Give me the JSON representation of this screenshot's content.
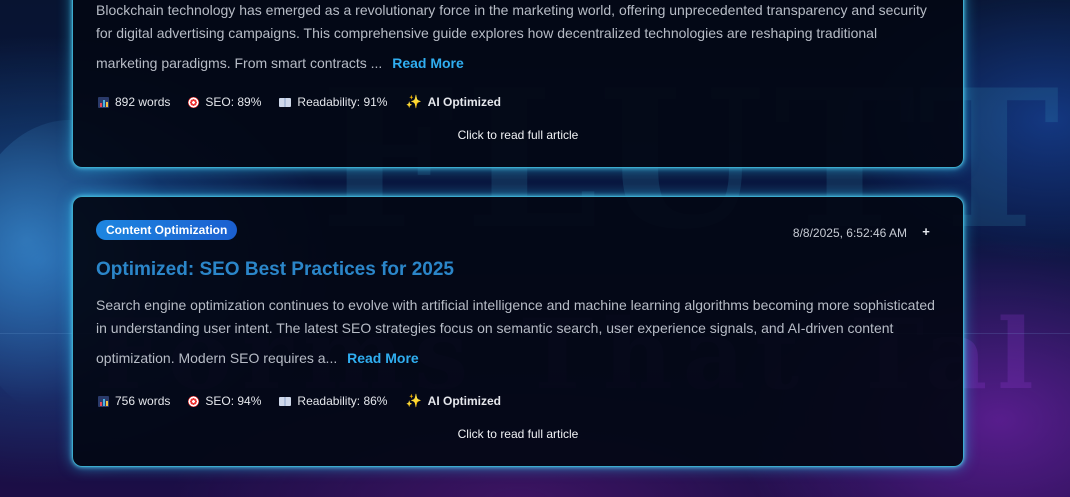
{
  "articles": [
    {
      "category": "",
      "date": "",
      "title": "",
      "excerpt_line1": "Blockchain technology has emerged as a revolutionary force in the marketing world, offering unprecedented transparency and security",
      "excerpt_line2": "for digital advertising campaigns. This comprehensive guide explores how decentralized technologies are reshaping traditional",
      "excerpt_line3": "marketing paradigms. From smart contracts ...",
      "read_more": "Read More",
      "words": "892 words",
      "seo": "SEO: 89%",
      "readability": "Readability: 91%",
      "ai_label": "AI Optimized",
      "cta": "Click to read full article"
    },
    {
      "category": "Content Optimization",
      "date": "8/8/2025, 6:52:46 AM",
      "plus": "+",
      "title": "Optimized: SEO Best Practices for 2025",
      "excerpt_line1": "Search engine optimization continues to evolve with artificial intelligence and machine learning algorithms becoming more sophisticated",
      "excerpt_line2": "in understanding user intent. The latest SEO strategies focus on semantic search, user experience signals, and AI-driven content",
      "excerpt_line3": "optimization. Modern SEO requires a...",
      "read_more": "Read More",
      "words": "756 words",
      "seo": "SEO: 94%",
      "readability": "Readability: 86%",
      "ai_label": "AI Optimized",
      "cta": "Click to read full article"
    }
  ],
  "background": {
    "word_top": "FLUTTER B",
    "word_bottom": "Forms That Tal"
  },
  "colors": {
    "accent_cyan": "#30aef0",
    "tag_blue": "#1d86e0",
    "title_blue": "#2b86c9",
    "card_glow": "#46c8f0"
  },
  "icons": {
    "words": "bar-chart-icon",
    "seo": "target-icon",
    "readability": "book-icon",
    "ai": "sparkle-icon"
  }
}
